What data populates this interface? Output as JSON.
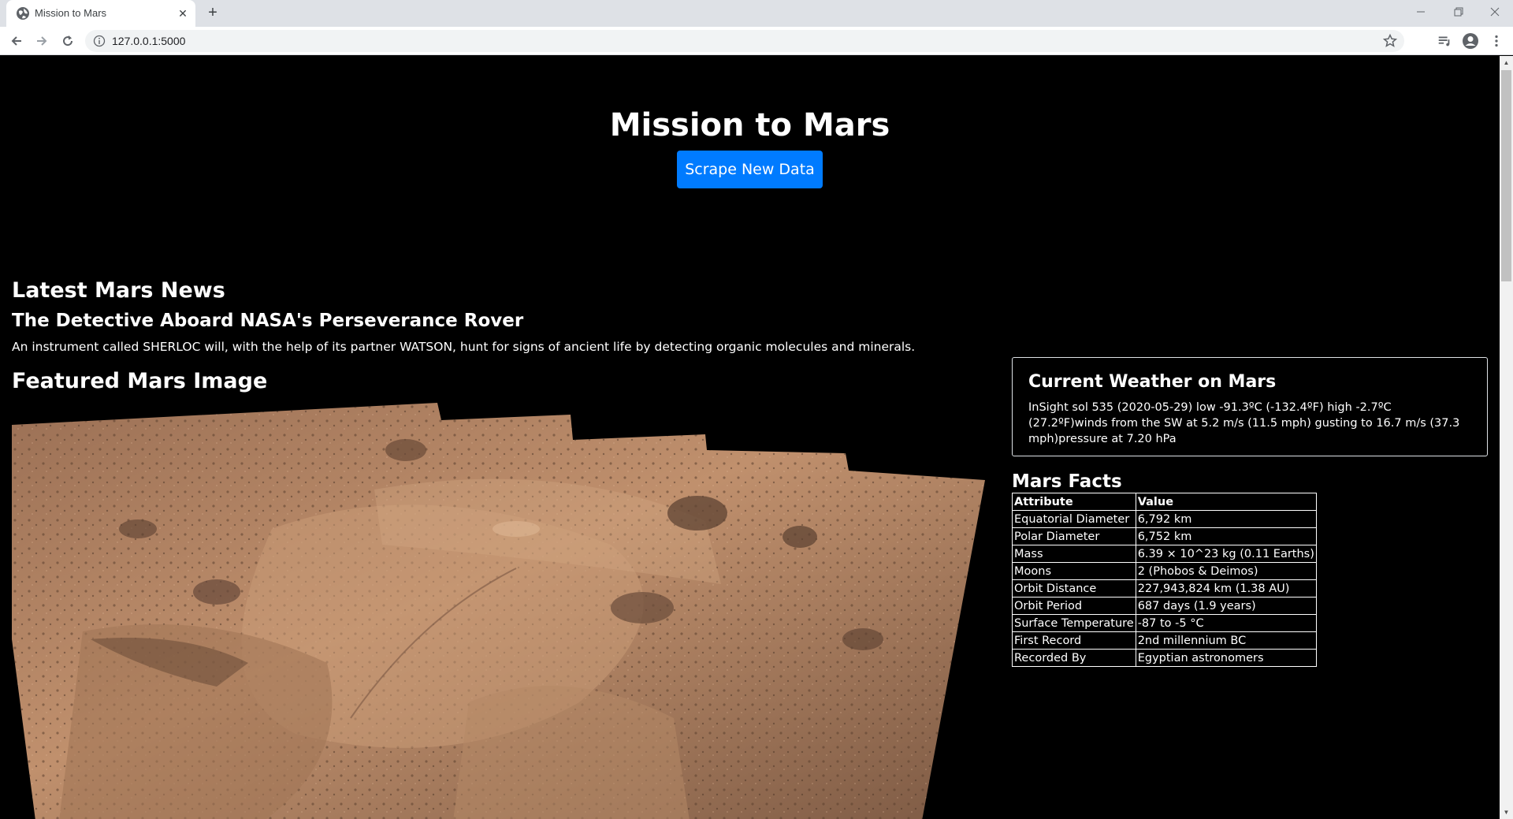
{
  "browser": {
    "tab_title": "Mission to Mars",
    "url": "127.0.0.1:5000"
  },
  "page": {
    "title": "Mission to Mars",
    "scrape_button": "Scrape New Data",
    "news": {
      "heading": "Latest Mars News",
      "title": "The Detective Aboard NASA's Perseverance Rover",
      "teaser": "An instrument called SHERLOC will, with the help of its partner WATSON, hunt for signs of ancient life by detecting organic molecules and minerals."
    },
    "featured": {
      "heading": "Featured Mars Image"
    },
    "weather": {
      "heading": "Current Weather on Mars",
      "text": "InSight sol 535 (2020-05-29) low -91.3ºC (-132.4ºF) high -2.7ºC (27.2ºF)winds from the SW at 5.2 m/s (11.5 mph) gusting to 16.7 m/s (37.3 mph)pressure at 7.20 hPa"
    },
    "facts": {
      "heading": "Mars Facts",
      "columns": [
        "Attribute",
        "Value"
      ],
      "rows": [
        [
          "Equatorial Diameter",
          "6,792 km"
        ],
        [
          "Polar Diameter",
          "6,752 km"
        ],
        [
          "Mass",
          "6.39 × 10^23 kg (0.11 Earths)"
        ],
        [
          "Moons",
          "2 (Phobos & Deimos)"
        ],
        [
          "Orbit Distance",
          "227,943,824 km (1.38 AU)"
        ],
        [
          "Orbit Period",
          "687 days (1.9 years)"
        ],
        [
          "Surface Temperature",
          "-87 to -5 °C"
        ],
        [
          "First Record",
          "2nd millennium BC"
        ],
        [
          "Recorded By",
          "Egyptian astronomers"
        ]
      ]
    }
  }
}
